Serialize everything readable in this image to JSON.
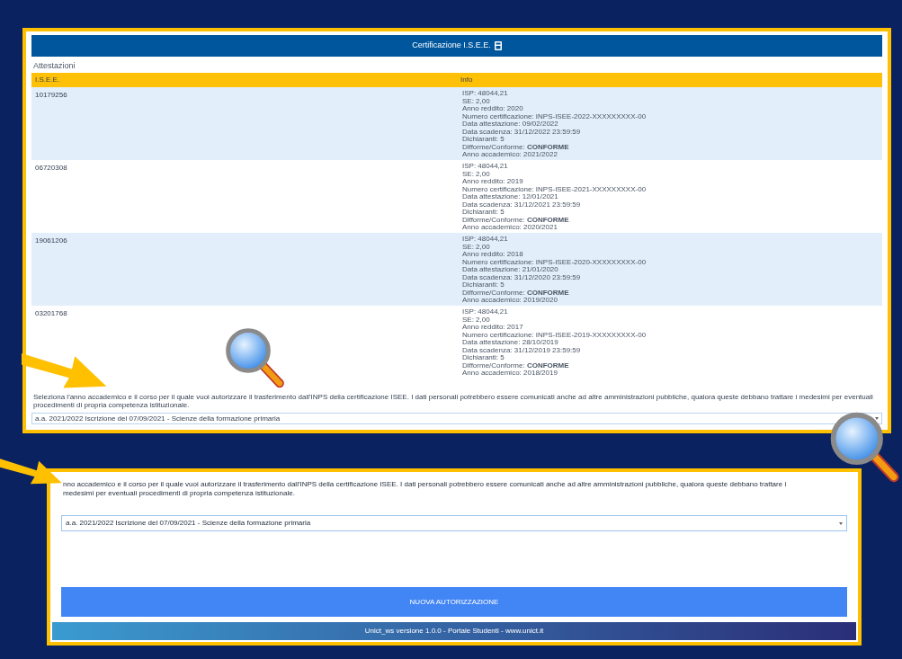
{
  "top_screen": {
    "header": {
      "title": "Certificazione I.S.E.E."
    },
    "section_title": "Attestazioni",
    "table": {
      "columns": [
        "I.S.E.E.",
        "Info"
      ],
      "rows": [
        {
          "isee": "10179256",
          "info": [
            "ISP: 48044,21",
            "SE: 2,00",
            "Anno reddito: 2020",
            "Numero certificazione: INPS-ISEE-2022-XXXXXXXXX-00",
            "Data attestazione: 09/02/2022",
            "Data scadenza: 31/12/2022 23:59:59",
            "Dichiaranti: 5",
            "Difforme/Conforme: **CONFORME**",
            "Anno accademico: 2021/2022"
          ]
        },
        {
          "isee": "06720308",
          "info": [
            "ISP: 48044,21",
            "SE: 2,00",
            "Anno reddito: 2019",
            "Numero certificazione: INPS-ISEE-2021-XXXXXXXXX-00",
            "Data attestazione: 12/01/2021",
            "Data scadenza: 31/12/2021 23:59:59",
            "Dichiaranti: 5",
            "Difforme/Conforme: **CONFORME**",
            "Anno accademico: 2020/2021"
          ]
        },
        {
          "isee": "19061206",
          "info": [
            "ISP: 48044,21",
            "SE: 2,00",
            "Anno reddito: 2018",
            "Numero certificazione: INPS-ISEE-2020-XXXXXXXXX-00",
            "Data attestazione: 21/01/2020",
            "Data scadenza: 31/12/2020 23:59:59",
            "Dichiaranti: 5",
            "Difforme/Conforme: **CONFORME**",
            "Anno accademico: 2019/2020"
          ]
        },
        {
          "isee": "03201768",
          "info": [
            "ISP: 48044,21",
            "SE: 2,00",
            "Anno reddito: 2017",
            "Numero certificazione: INPS-ISEE-2019-XXXXXXXXX-00",
            "Data attestazione: 28/10/2019",
            "Data scadenza: 31/12/2019 23:59:59",
            "Dichiaranti: 5",
            "Difforme/Conforme: **CONFORME**",
            "Anno accademico: 2018/2019"
          ]
        }
      ]
    },
    "instruction": "Seleziona l'anno accademico e il corso per il quale vuoi autorizzare il trasferimento dall'INPS della certificazione ISEE. I dati personali potrebbero essere comunicati anche ad altre amministrazioni pubbliche, qualora queste debbano trattare i medesimi per eventuali procedimenti di propria competenza istituzionale.",
    "select_value": "a.a. 2021/2022 Iscrizione del 07/09/2021 - Scienze della formazione primaria"
  },
  "bottom_screen": {
    "instruction": "nno accademico e il corso per il quale vuoi autorizzare il trasferimento dall'INPS della certificazione ISEE. I dati personali potrebbero essere comunicati anche ad altre amministrazioni pubbliche, qualora queste debbano trattare i medesimi per eventuali procedimenti di propria competenza istituzionale.",
    "select_value": "a.a. 2021/2022 Iscrizione del 07/09/2021 - Scienze della formazione primaria",
    "button": "NUOVA AUTORIZZAZIONE",
    "footer": "Unict_ws versione 1.0.0 - Portale Studenti - www.unict.it"
  }
}
